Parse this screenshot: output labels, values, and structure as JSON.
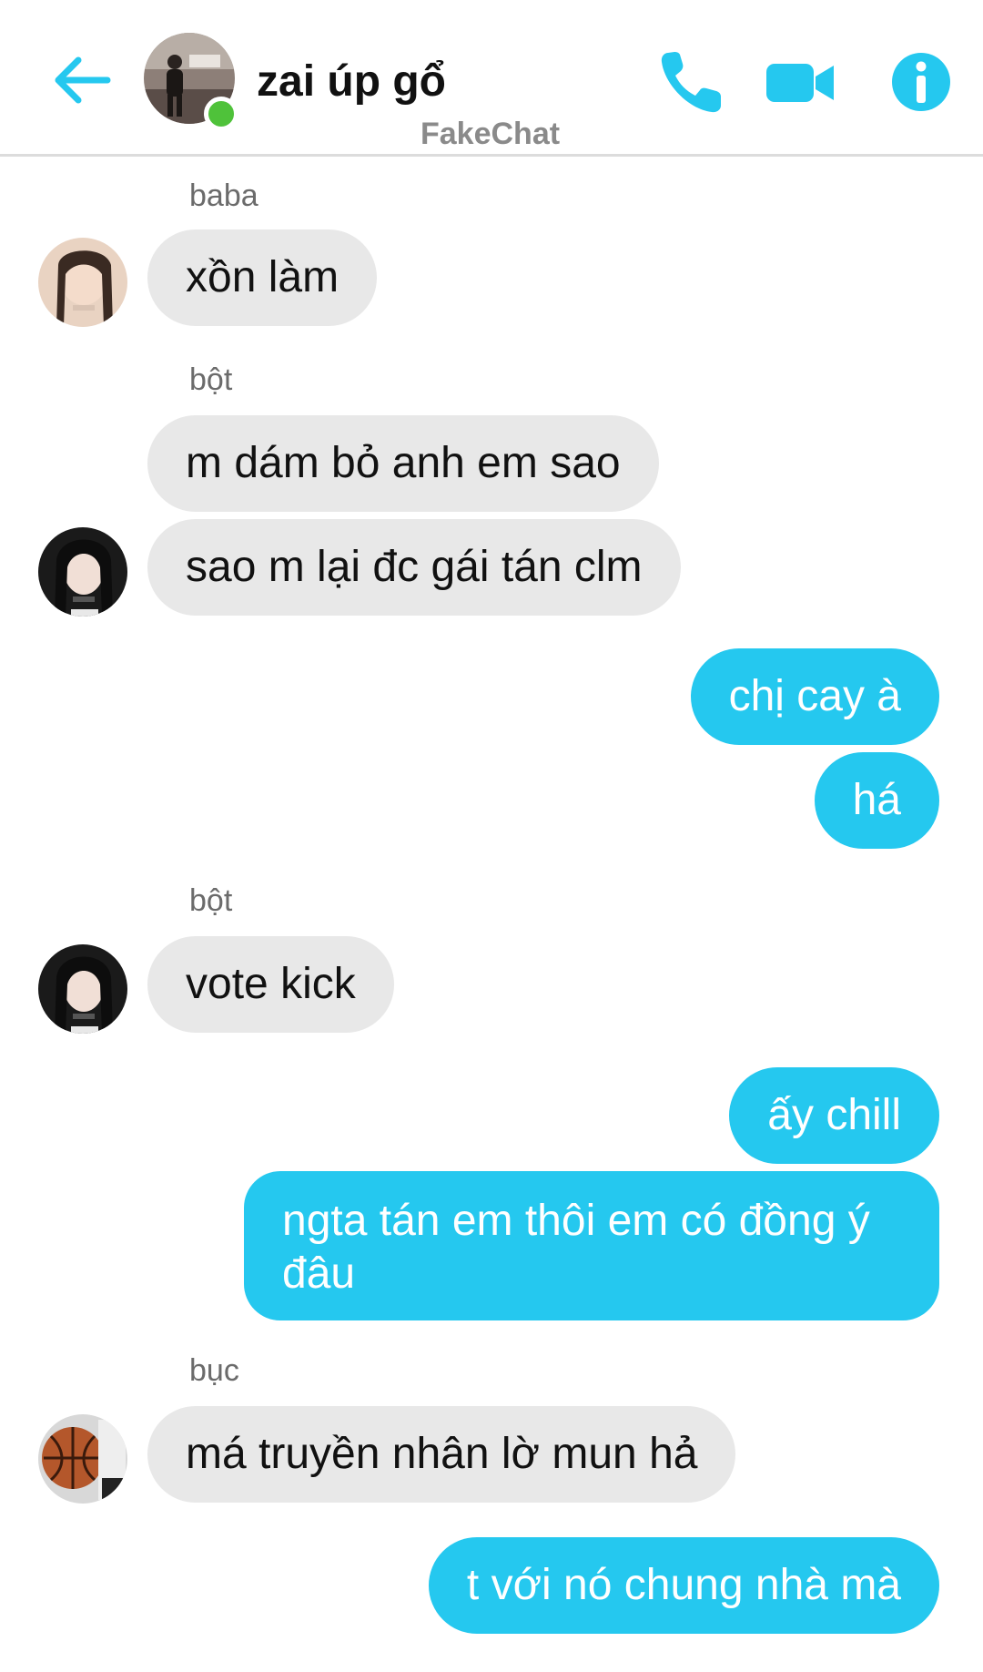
{
  "header": {
    "title": "zai úp gổ",
    "subtitle": "FakeChat",
    "accent_color": "#25c8ef",
    "online_color": "#4fc23a",
    "icons": [
      "back-arrow-icon",
      "phone-icon",
      "video-camera-icon",
      "info-icon"
    ]
  },
  "messages": [
    {
      "sender": "baba",
      "text": "xồn làm",
      "direction": "incoming"
    },
    {
      "sender": "bột",
      "text": "m dám bỏ anh em sao",
      "direction": "incoming"
    },
    {
      "text": "sao m lại đc gái tán clm",
      "direction": "incoming"
    },
    {
      "text": "chị cay à",
      "direction": "outgoing"
    },
    {
      "text": "há",
      "direction": "outgoing"
    },
    {
      "sender": "bột",
      "text": "vote kick",
      "direction": "incoming"
    },
    {
      "text": "ấy chill",
      "direction": "outgoing"
    },
    {
      "text": "ngta tán em thôi em có đồng ý đâu",
      "direction": "outgoing"
    },
    {
      "sender": "bục",
      "text": "má truyền nhân lờ mun hả",
      "direction": "incoming"
    },
    {
      "text": "t với nó chung nhà mà",
      "direction": "outgoing"
    }
  ]
}
